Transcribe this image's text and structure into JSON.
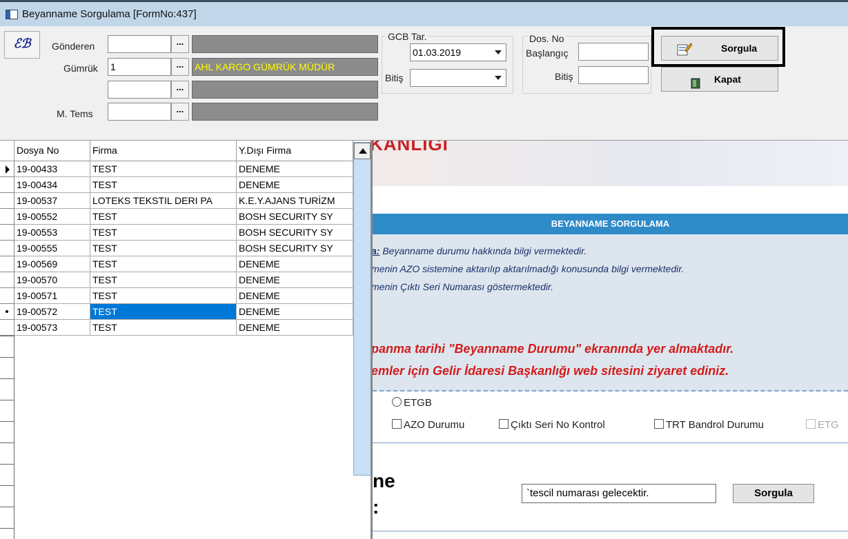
{
  "window": {
    "title": "Beyanname Sorgulama [FormNo:437]"
  },
  "toolbar": {
    "eb_label": "ℰℬ",
    "gonderen_label": "Gönderen",
    "gonderen_value": "",
    "gumruk_label": "Gümrük",
    "gumruk_value": "1",
    "gumruk_name": "AHL KARGO GÜMRÜK MÜDÜR",
    "mtems_label": "M. Tems",
    "dots": "...",
    "gcb_label": "GCB Tar.",
    "gcb_start": "01.03.2019",
    "bitis_label": "Bitiş",
    "gcb_end": "",
    "dosno_label": "Dos. No",
    "baslangic_label": "Başlangıç",
    "sorgula_label": "Sorgula",
    "kapat_label": "Kapat"
  },
  "grid": {
    "columns": [
      "Dosya No",
      "Firma",
      "Y.Dışı Firma"
    ],
    "rows": [
      {
        "dosya": "19-00433",
        "firma": "TEST",
        "ydisi": "DENEME",
        "indicator": "current"
      },
      {
        "dosya": "19-00434",
        "firma": "TEST",
        "ydisi": "DENEME",
        "indicator": ""
      },
      {
        "dosya": "19-00537",
        "firma": "LOTEKS TEKSTIL DERI PA",
        "ydisi": "K.E.Y.AJANS TURİZM",
        "indicator": ""
      },
      {
        "dosya": "19-00552",
        "firma": "TEST",
        "ydisi": "BOSH SECURITY  SY",
        "indicator": ""
      },
      {
        "dosya": "19-00553",
        "firma": "TEST",
        "ydisi": "BOSH SECURITY  SY",
        "indicator": ""
      },
      {
        "dosya": "19-00555",
        "firma": "TEST",
        "ydisi": "BOSH SECURITY  SY",
        "indicator": ""
      },
      {
        "dosya": "19-00569",
        "firma": "TEST",
        "ydisi": "DENEME",
        "indicator": ""
      },
      {
        "dosya": "19-00570",
        "firma": "TEST",
        "ydisi": "DENEME",
        "indicator": ""
      },
      {
        "dosya": "19-00571",
        "firma": "TEST",
        "ydisi": "DENEME",
        "indicator": ""
      },
      {
        "dosya": "19-00572",
        "firma": "TEST",
        "ydisi": "DENEME",
        "indicator": "edit",
        "selected": true
      },
      {
        "dosya": "19-00573",
        "firma": "TEST",
        "ydisi": "DENEME",
        "indicator": ""
      }
    ]
  },
  "web": {
    "banner_text": "KANLIĞI",
    "band_title": "BEYANNAME SORGULAMA",
    "info_1_prefix": "a:",
    "info_1": " Beyanname durumu hakkında bilgi vermektedir.",
    "info_2": "menin AZO sistemine aktarılıp aktarılmadığı konusunda bilgi vermektedir.",
    "info_3": "menin Çıktı Seri Numarası göstermektedir.",
    "red_1": "panma tarihi \"Beyanname Durumu\" ekranında yer almaktadır.",
    "red_2": "emler için Gelir İdaresi Başkanlığı web sitesini ziyaret ediniz.",
    "opt_etgb": "ETGB",
    "opt_azo": "AZO Durumu",
    "opt_cikti": "Çıktı Seri No Kontrol",
    "opt_trt": "TRT Bandrol Durumu",
    "opt_etg": "ETG",
    "heading_1": "ne",
    "heading_2": ":",
    "input_value": "`tescil numarası gelecektir.",
    "button_label": "Sorgula"
  }
}
